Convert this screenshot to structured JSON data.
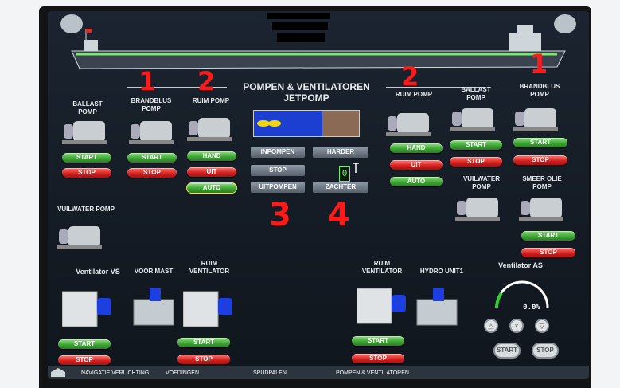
{
  "header": {
    "title": "POMPEN & VENTILATOREN",
    "subtitle": "JETPOMP"
  },
  "pumps": {
    "ballast_left": "BALLAST POMP",
    "brandblus_left": "BRANDBLUS POMP",
    "ruim_left": "RUIM POMP",
    "ruim_right": "RUIM POMP",
    "ballast_right": "BALLAST POMP",
    "brandblus_right": "BRANDBLUS POMP",
    "vuilwater_left": "VUILWATER POMP",
    "vuilwater_right": "VUILWATER POMP",
    "smeer_olie": "SMEER OLIE POMP"
  },
  "buttons": {
    "start": "START",
    "stop": "STOP",
    "hand": "HAND",
    "uit": "UIT",
    "auto": "AUTO"
  },
  "jetpomp": {
    "inpompen": "INPOMPEN",
    "stop": "STOP",
    "uitpompen": "UITPOMPEN",
    "harder": "HARDER",
    "zachter": "ZACHTER",
    "level_digit": "0",
    "level_fraction": 0.65
  },
  "ventilators": {
    "vs_title": "Ventilator VS",
    "voor_mast": "VOOR MAST",
    "ruim_vent_left": "RUIM VENTILATOR",
    "ruim_vent_right": "RUIM VENTILATOR",
    "hydro_unit": "HYDRO UNIT1",
    "as_title": "Ventilator AS",
    "as_percent": "0.0%",
    "as_start": "START",
    "as_stop": "STOP"
  },
  "annotations": {
    "one": "1",
    "two": "2",
    "three": "3",
    "four": "4"
  },
  "tabs": [
    "NAVIGATIE VERLICHTING",
    "VOEDINGEN",
    "SPUDPALEN",
    "POMPEN & VENTILATOREN"
  ],
  "colors": {
    "start": "#3aa132",
    "stop": "#d21d1d",
    "annotation": "#ff1a1a",
    "hull_line": "#7bea6a"
  }
}
